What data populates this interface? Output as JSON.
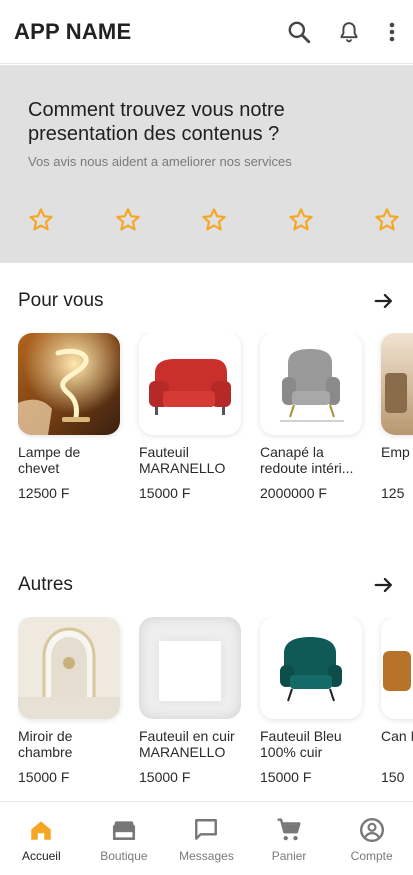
{
  "app": {
    "title": "APP NAME"
  },
  "header": {
    "icons": [
      "search-icon",
      "bell-icon",
      "more-vert-icon"
    ]
  },
  "rating": {
    "question": "Comment trouvez vous notre presentation des contenus ?",
    "subtitle": "Vos avis nous aident a ameliorer nos services",
    "star_count": 5,
    "star_color": "#f5a623"
  },
  "sections": [
    {
      "title": "Pour vous",
      "products": [
        {
          "name": "Lampe de chevet",
          "price": "12500 F"
        },
        {
          "name": "Fauteuil MARANELLO",
          "price": "15000 F"
        },
        {
          "name": "Canapé la redoute intéri...",
          "price": "2000000 F"
        },
        {
          "name": "Emp cha",
          "price": "125"
        }
      ]
    },
    {
      "title": "Autres",
      "products": [
        {
          "name": "Miroir de chambre",
          "price": "15000 F"
        },
        {
          "name": "Fauteuil en cuir MARANELLO",
          "price": "15000 F"
        },
        {
          "name": "Fauteuil Bleu 100% cuir",
          "price": "15000 F"
        },
        {
          "name": "Can MA",
          "price": "150"
        }
      ]
    }
  ],
  "bottom_nav": {
    "active": "Accueil",
    "active_color": "#f5a623",
    "items": [
      {
        "label": "Accueil",
        "icon": "home-icon"
      },
      {
        "label": "Boutique",
        "icon": "store-icon"
      },
      {
        "label": "Messages",
        "icon": "chat-icon"
      },
      {
        "label": "Panier",
        "icon": "cart-icon"
      },
      {
        "label": "Compte",
        "icon": "account-icon"
      }
    ]
  }
}
